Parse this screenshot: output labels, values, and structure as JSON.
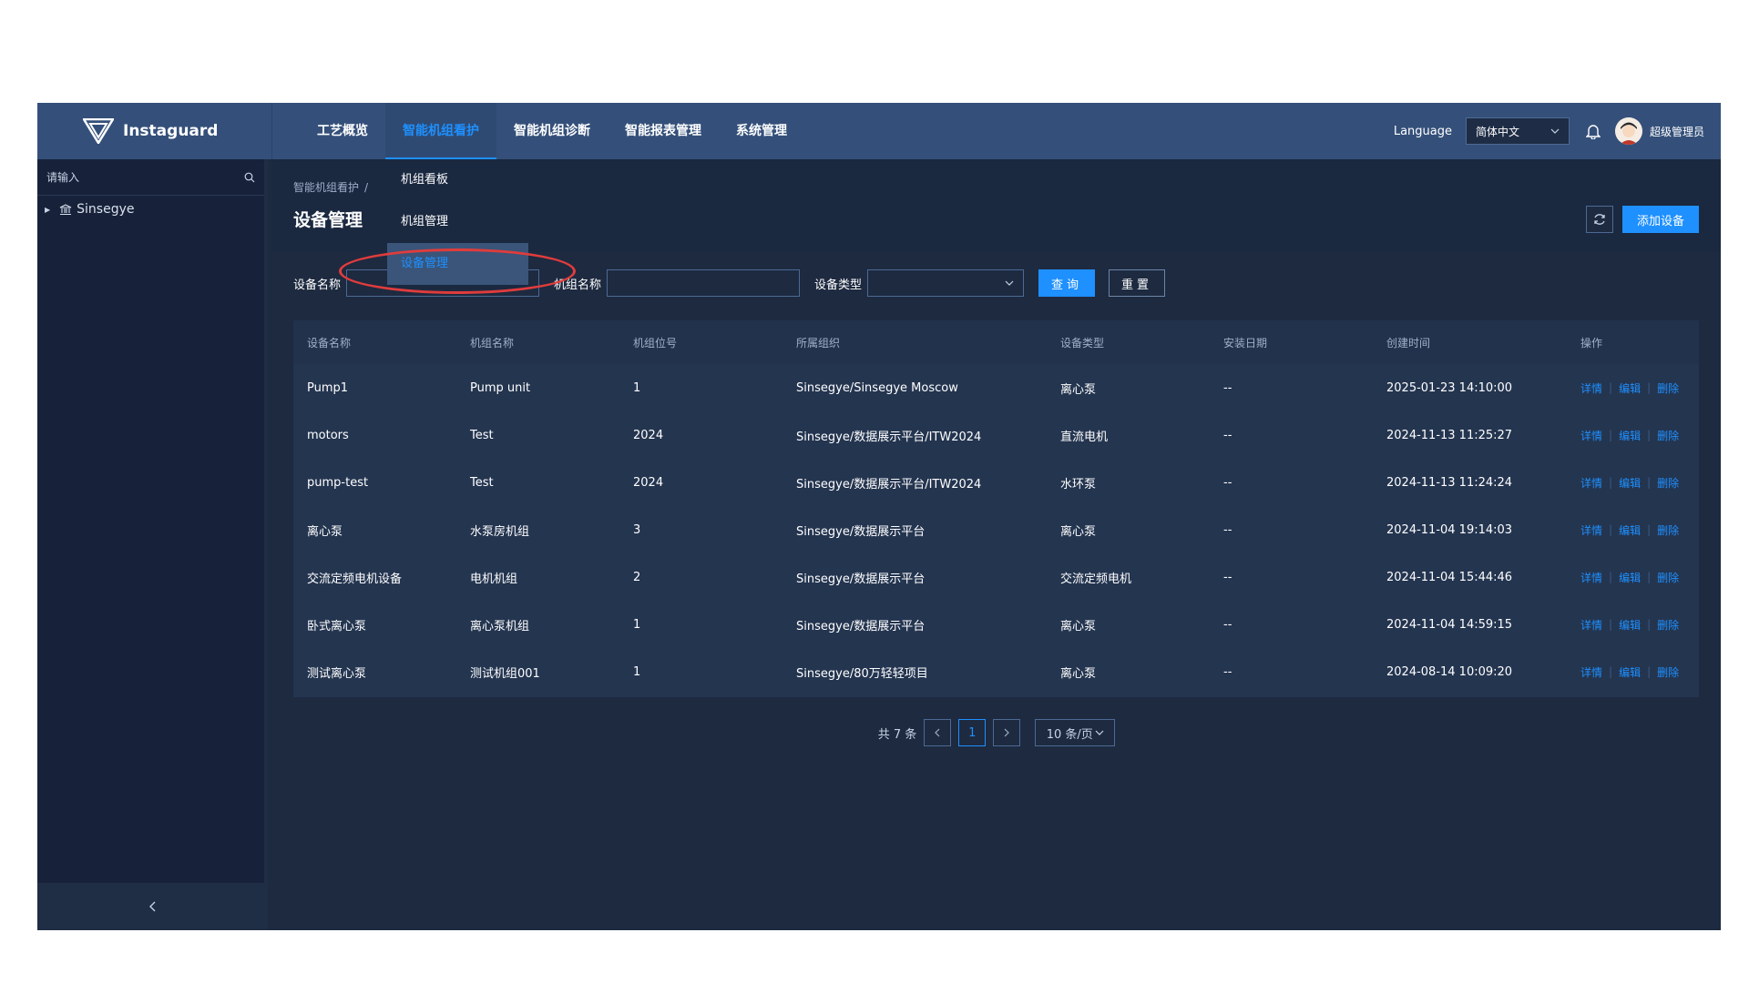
{
  "app": {
    "name": "Instaguard"
  },
  "nav": {
    "items": [
      {
        "label": "工艺概览"
      },
      {
        "label": "智能机组看护"
      },
      {
        "label": "智能机组诊断"
      },
      {
        "label": "智能报表管理"
      },
      {
        "label": "系统管理"
      }
    ],
    "active_index": 1
  },
  "topbar": {
    "language_label": "Language",
    "language_value": "简体中文",
    "username": "超级管理员"
  },
  "sidebar": {
    "search_placeholder": "请输入",
    "tree": [
      {
        "label": "Sinsegye"
      }
    ],
    "collapse_icon": "chevron-left-icon"
  },
  "dropdown": {
    "items": [
      {
        "label": "机组看板"
      },
      {
        "label": "机组管理"
      },
      {
        "label": "设备管理"
      }
    ],
    "active_index": 2
  },
  "breadcrumb": {
    "parent": "智能机组看护",
    "separator": "/"
  },
  "page": {
    "title": "设备管理",
    "add_button": "添加设备"
  },
  "filters": {
    "device_name_label": "设备名称",
    "unit_name_label": "机组名称",
    "device_type_label": "设备类型",
    "query_button": "查询",
    "reset_button": "重置"
  },
  "table": {
    "columns": [
      "设备名称",
      "机组名称",
      "机组位号",
      "所属组织",
      "设备类型",
      "安装日期",
      "创建时间",
      "操作"
    ],
    "rows": [
      {
        "name": "Pump1",
        "unit": "Pump unit",
        "position": "1",
        "org": "Sinsegye/Sinsegye Moscow",
        "type": "离心泵",
        "install_date": "--",
        "created": "2025-01-23 14:10:00"
      },
      {
        "name": "motors",
        "unit": "Test",
        "position": "2024",
        "org": "Sinsegye/数据展示平台/ITW2024",
        "type": "直流电机",
        "install_date": "--",
        "created": "2024-11-13 11:25:27"
      },
      {
        "name": "pump-test",
        "unit": "Test",
        "position": "2024",
        "org": "Sinsegye/数据展示平台/ITW2024",
        "type": "水环泵",
        "install_date": "--",
        "created": "2024-11-13 11:24:24"
      },
      {
        "name": "离心泵",
        "unit": "水泵房机组",
        "position": "3",
        "org": "Sinsegye/数据展示平台",
        "type": "离心泵",
        "install_date": "--",
        "created": "2024-11-04 19:14:03"
      },
      {
        "name": "交流定频电机设备",
        "unit": "电机机组",
        "position": "2",
        "org": "Sinsegye/数据展示平台",
        "type": "交流定频电机",
        "install_date": "--",
        "created": "2024-11-04 15:44:46"
      },
      {
        "name": "卧式离心泵",
        "unit": "离心泵机组",
        "position": "1",
        "org": "Sinsegye/数据展示平台",
        "type": "离心泵",
        "install_date": "--",
        "created": "2024-11-04 14:59:15"
      },
      {
        "name": "测试离心泵",
        "unit": "测试机组001",
        "position": "1",
        "org": "Sinsegye/80万轻轻项目",
        "type": "离心泵",
        "install_date": "--",
        "created": "2024-08-14 10:09:20"
      }
    ],
    "actions": {
      "detail": "详情",
      "edit": "编辑",
      "delete": "删除"
    }
  },
  "pagination": {
    "total_text": "共 7 条",
    "current_page": "1",
    "page_size": "10 条/页",
    "prev_icon": "chevron-left-icon",
    "next_icon": "chevron-right-icon"
  },
  "colors": {
    "accent": "#1e90ff",
    "topbar": "#34507a",
    "background": "#1d2a40",
    "highlight": "#e03c3c"
  }
}
